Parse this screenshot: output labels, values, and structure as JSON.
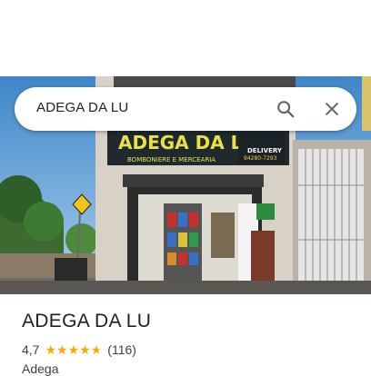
{
  "search": {
    "query": "ADEGA DA LU"
  },
  "photo": {
    "sign_title": "ADEGA DA LU",
    "sign_subtitle": "BOMBONIERE E MERCEARIA",
    "sign_delivery": "DELIVERY",
    "sign_phone": "94280-7293"
  },
  "place": {
    "name": "ADEGA DA LU",
    "rating": "4,7",
    "rating_stars": 4.7,
    "review_count": "(116)",
    "category": "Adega"
  },
  "colors": {
    "star": "#f9ab00",
    "icon": "#5f6368",
    "text": "#202124"
  }
}
